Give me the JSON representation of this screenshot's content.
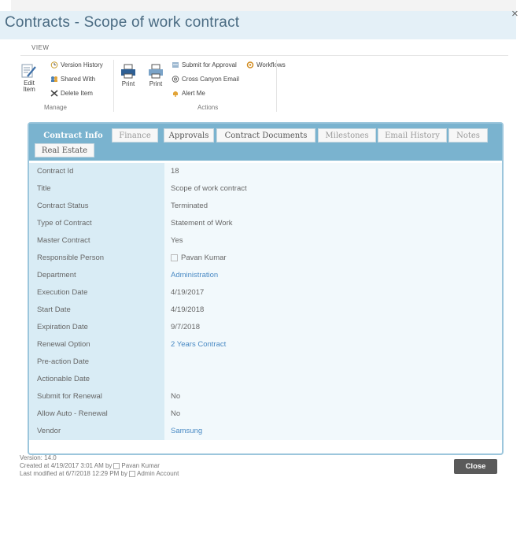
{
  "dialog": {
    "title": "Contracts - Scope of work contract",
    "close_x": "×"
  },
  "ribbon": {
    "tab": "VIEW",
    "manage": {
      "edit_item": [
        "Edit",
        "Item"
      ],
      "version_history": "Version History",
      "shared_with": "Shared With",
      "delete_item": "Delete Item",
      "group_label": "Manage"
    },
    "actions": {
      "print1": "Print",
      "print2": "Print",
      "submit_for_approval": "Submit for Approval",
      "workflows": "Workflows",
      "cross_canyon_email": "Cross Canyon Email",
      "alert_me": "Alert Me",
      "group_label": "Actions"
    }
  },
  "tabs": [
    {
      "label": "Contract Info",
      "active": true
    },
    {
      "label": "Finance"
    },
    {
      "label": "Approvals"
    },
    {
      "label": "Contract Documents"
    },
    {
      "label": "Milestones"
    },
    {
      "label": "Email History"
    },
    {
      "label": "Notes"
    },
    {
      "label": "Real Estate"
    }
  ],
  "fields": [
    {
      "label": "Contract Id",
      "value": "18"
    },
    {
      "label": "Title",
      "value": "Scope of work contract"
    },
    {
      "label": "Contract Status",
      "value": "Terminated"
    },
    {
      "label": "Type of Contract",
      "value": "Statement of Work"
    },
    {
      "label": "Master Contract",
      "value": "Yes"
    },
    {
      "label": "Responsible Person",
      "value": "Pavan Kumar"
    },
    {
      "label": "Department",
      "value": "Administration"
    },
    {
      "label": "Execution Date",
      "value": "4/19/2017"
    },
    {
      "label": "Start Date",
      "value": "4/19/2018"
    },
    {
      "label": "Expiration Date",
      "value": "9/7/2018"
    },
    {
      "label": "Renewal Option",
      "value": "2 Years Contract"
    },
    {
      "label": "Pre-action Date",
      "value": ""
    },
    {
      "label": "Actionable Date",
      "value": ""
    },
    {
      "label": "Submit for Renewal",
      "value": "No"
    },
    {
      "label": "Allow Auto - Renewal",
      "value": "No"
    },
    {
      "label": "Vendor",
      "value": "Samsung"
    }
  ],
  "footer": {
    "version": "Version: 14.0",
    "created_prefix": "Created at 4/19/2017 3:01 AM  by",
    "created_by": "Pavan Kumar",
    "modified_prefix": "Last modified at 6/7/2018 12:29 PM  by",
    "modified_by": "Admin Account"
  },
  "close_button": "Close",
  "colors": {
    "tab_bar": "#7ab3cf",
    "label_bg": "#d9ecf5",
    "value_bg": "#f2f9fc",
    "link": "#4a8ac4",
    "title": "#4a6b82",
    "close_button": "#5a5a5a"
  }
}
